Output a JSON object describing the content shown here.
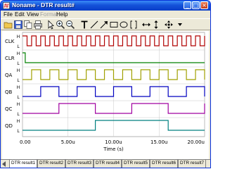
{
  "window": {
    "title": "Noname - DTR result#"
  },
  "titlebar_buttons": {
    "minimize": "_",
    "maximize": "□",
    "close": "×"
  },
  "menu": [
    {
      "label": "File",
      "enabled": true
    },
    {
      "label": "Edit",
      "enabled": true
    },
    {
      "label": "View",
      "enabled": true
    },
    {
      "label": "Format",
      "enabled": false
    },
    {
      "label": "Help",
      "enabled": true
    }
  ],
  "toolbar": {
    "icons": [
      "open-icon",
      "save-icon",
      "copy-icon",
      "print-icon",
      "pointer-icon",
      "zoom-in-icon",
      "zoom-out-icon",
      "text-icon",
      "line-icon",
      "arrow-icon",
      "rectangle-icon",
      "ellipse-icon",
      "bracket-icon",
      "horizontal-cursor-icon",
      "vertical-cursor-icon",
      "move-icon",
      "dropdown-icon"
    ]
  },
  "colors": {
    "CLK": "#b00000",
    "CLR": "#008000",
    "QA": "#a0a000",
    "QB": "#0000c0",
    "QC": "#a000a0",
    "QD": "#008080",
    "grid": "#c8c8c8"
  },
  "chart_data": {
    "type": "line",
    "xlabel": "Time (s)",
    "xlim": [
      0,
      20
    ],
    "x_ticks": [
      "0.00",
      "5.00u",
      "10.00u",
      "15.00u",
      "20.00u"
    ],
    "level_labels": {
      "high": "H",
      "low": "L"
    },
    "signals": [
      {
        "name": "CLK",
        "edges": [
          0.5,
          1,
          1.5,
          2,
          2.5,
          3,
          3.5,
          4,
          4.5,
          5,
          5.5,
          6,
          6.5,
          7,
          7.5,
          8,
          8.5,
          9,
          9.5,
          10,
          10.5,
          11,
          11.5,
          12,
          12.5,
          13,
          13.5,
          14,
          14.5,
          15,
          15.5,
          16,
          16.5,
          17,
          17.5,
          18,
          18.5,
          19,
          19.5,
          20
        ],
        "start": 1
      },
      {
        "name": "CLR",
        "edges": [
          0.3
        ],
        "start": 1
      },
      {
        "name": "QA",
        "edges": [
          1,
          2,
          3,
          4,
          5,
          6,
          7,
          8,
          9,
          10,
          11,
          12,
          13,
          14,
          15,
          16,
          17,
          18,
          19,
          20
        ],
        "start": 0
      },
      {
        "name": "QB",
        "edges": [
          2,
          4,
          6,
          8,
          10,
          12,
          14,
          16,
          18,
          20
        ],
        "start": 0
      },
      {
        "name": "QC",
        "edges": [
          4,
          8,
          12,
          16,
          20
        ],
        "start": 0
      },
      {
        "name": "QD",
        "edges": [
          8,
          16
        ],
        "start": 0
      }
    ]
  },
  "tabs": [
    {
      "label": "DTR result1",
      "active": true
    },
    {
      "label": "DTR result2",
      "active": false
    },
    {
      "label": "DTR result3",
      "active": false
    },
    {
      "label": "DTR result4",
      "active": false
    },
    {
      "label": "DTR result5",
      "active": false
    },
    {
      "label": "DTR result6",
      "active": false
    },
    {
      "label": "DTR result7",
      "active": false
    }
  ]
}
